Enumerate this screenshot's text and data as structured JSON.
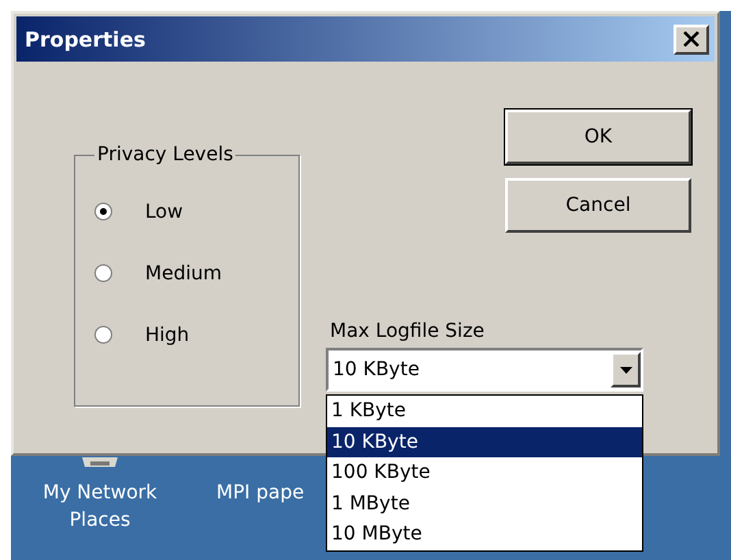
{
  "window": {
    "title": "Properties"
  },
  "privacy_levels": {
    "label": "Privacy Levels",
    "options": [
      {
        "label": "Low",
        "selected": true
      },
      {
        "label": "Medium",
        "selected": false
      },
      {
        "label": "High",
        "selected": false
      }
    ]
  },
  "buttons": [
    {
      "label": "OK",
      "default": true
    },
    {
      "label": "Cancel",
      "default": false
    }
  ],
  "max_logfile_size": {
    "label": "Max Logfile Size",
    "value": "10 KByte",
    "expanded": true,
    "options": [
      {
        "label": "1 KByte",
        "selected": false
      },
      {
        "label": "10 KByte",
        "selected": true
      },
      {
        "label": "100 KByte",
        "selected": false
      },
      {
        "label": "1 MByte",
        "selected": false
      },
      {
        "label": "10 MByte",
        "selected": false
      }
    ]
  },
  "desktop": {
    "icons": [
      {
        "label": "My Network Places"
      },
      {
        "label": "MPI pape"
      }
    ]
  }
}
